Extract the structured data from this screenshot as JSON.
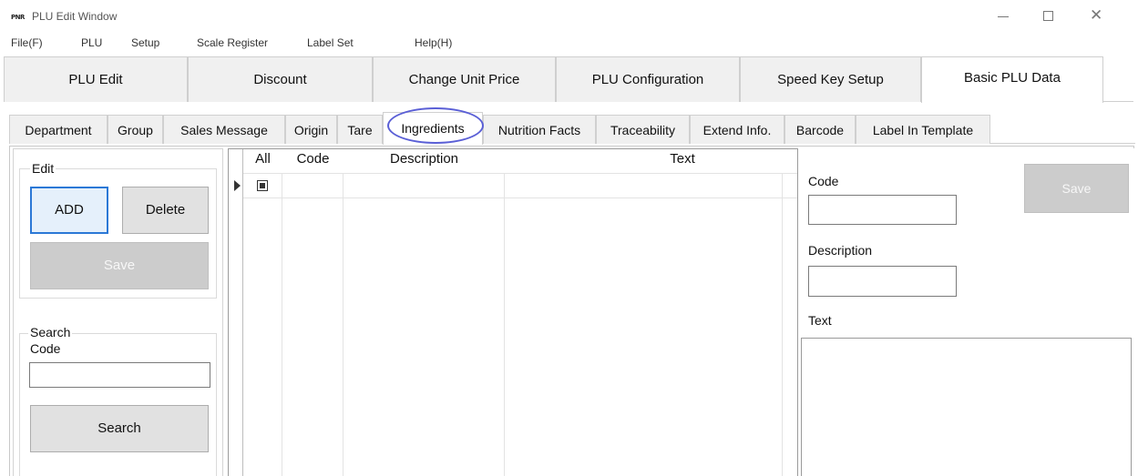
{
  "window": {
    "logo_text": "PNR",
    "title": "PLU Edit Window"
  },
  "menu": [
    "File(F)",
    "PLU",
    "Setup",
    "Scale Register",
    "Label Set",
    "Help(H)"
  ],
  "main_tabs": [
    "PLU Edit",
    "Discount",
    "Change Unit Price",
    "PLU Configuration",
    "Speed Key Setup",
    "Basic PLU Data"
  ],
  "sub_tabs": [
    "Department",
    "Group",
    "Sales Message",
    "Origin",
    "Tare",
    "Ingredients",
    "Nutrition Facts",
    "Traceability",
    "Extend Info.",
    "Barcode",
    "Label In Template"
  ],
  "edit_group": {
    "legend": "Edit",
    "add_label": "ADD",
    "delete_label": "Delete",
    "save_label": "Save"
  },
  "search_group": {
    "legend": "Search",
    "code_label": "Code",
    "code_value": "",
    "search_label": "Search"
  },
  "grid": {
    "columns": [
      "All",
      "Code",
      "Description",
      "Text"
    ]
  },
  "detail": {
    "code_label": "Code",
    "description_label": "Description",
    "text_label": "Text",
    "save_label": "Save",
    "code_value": "",
    "description_value": "",
    "text_value": ""
  },
  "colors": {
    "highlight_ring": "#5a5fd6",
    "focus_border": "#2b78d6",
    "disabled_button": "#cccccc"
  }
}
